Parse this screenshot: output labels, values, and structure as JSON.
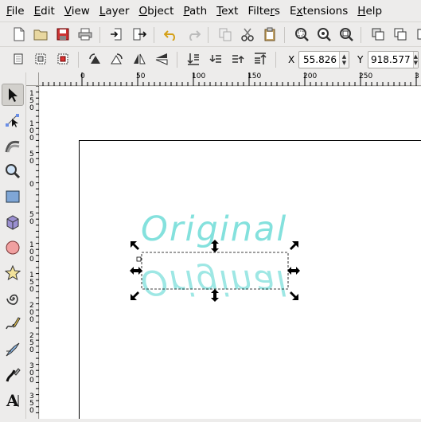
{
  "menu": {
    "items": [
      {
        "pre": "",
        "ul": "F",
        "post": "ile"
      },
      {
        "pre": "",
        "ul": "E",
        "post": "dit"
      },
      {
        "pre": "",
        "ul": "V",
        "post": "iew"
      },
      {
        "pre": "",
        "ul": "L",
        "post": "ayer"
      },
      {
        "pre": "",
        "ul": "O",
        "post": "bject"
      },
      {
        "pre": "",
        "ul": "P",
        "post": "ath"
      },
      {
        "pre": "",
        "ul": "T",
        "post": "ext"
      },
      {
        "pre": "Filte",
        "ul": "r",
        "post": "s"
      },
      {
        "pre": "E",
        "ul": "x",
        "post": "tensions"
      },
      {
        "pre": "",
        "ul": "H",
        "post": "elp"
      }
    ]
  },
  "coords": {
    "x_label": "X",
    "x_value": "55.826",
    "y_label": "Y",
    "y_value": "918.577"
  },
  "hruler": {
    "labels": [
      "0",
      "50",
      "100",
      "150",
      "200",
      "250",
      "3"
    ]
  },
  "vruler": {
    "labels": [
      "1\n5\n0",
      "1\n0\n0",
      "5\n0",
      "0",
      "5\n0",
      "1\n0\n0",
      "1\n5\n0",
      "2\n0\n0",
      "2\n5\n0",
      "3\n0\n0",
      "3\n5\n0"
    ]
  },
  "canvas": {
    "text_original": "Original",
    "text_reflection": "Original",
    "text_color": "#7ee0dc"
  },
  "colors": {
    "accent_undo": "#d4a017",
    "icon_dark": "#333333"
  }
}
